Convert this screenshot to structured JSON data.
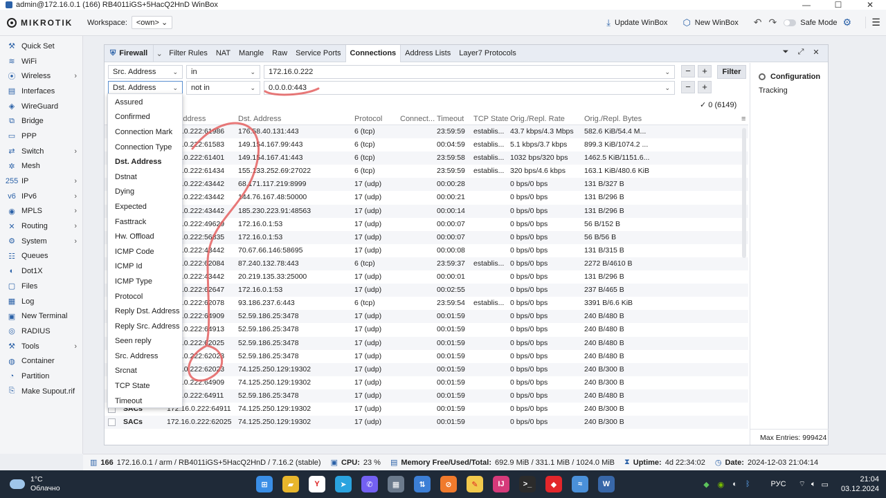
{
  "window": {
    "title": "admin@172.16.0.1 (166) RB4011iGS+5HacQ2HnD WinBox",
    "controls": [
      "—",
      "☐",
      "✕"
    ]
  },
  "toolbar": {
    "logo": "MIKROTIK",
    "workspace_label": "Workspace:",
    "workspace_value": "<own>",
    "update_label": "Update WinBox",
    "new_label": "New WinBox",
    "safe_mode_label": "Safe Mode"
  },
  "sidebar": {
    "items": [
      {
        "label": "Quick Set",
        "icon": "quickset-icon",
        "glyph": "⚒",
        "arrow": ""
      },
      {
        "label": "WiFi",
        "icon": "wifi-icon",
        "glyph": "≋",
        "arrow": ""
      },
      {
        "label": "Wireless",
        "icon": "wireless-icon",
        "glyph": "⦿",
        "arrow": "›"
      },
      {
        "label": "Interfaces",
        "icon": "interfaces-icon",
        "glyph": "▤",
        "arrow": ""
      },
      {
        "label": "WireGuard",
        "icon": "wireguard-icon",
        "glyph": "◈",
        "arrow": ""
      },
      {
        "label": "Bridge",
        "icon": "bridge-icon",
        "glyph": "⧉",
        "arrow": ""
      },
      {
        "label": "PPP",
        "icon": "ppp-icon",
        "glyph": "▭",
        "arrow": ""
      },
      {
        "label": "Switch",
        "icon": "switch-icon",
        "glyph": "⇄",
        "arrow": "›"
      },
      {
        "label": "Mesh",
        "icon": "mesh-icon",
        "glyph": "✲",
        "arrow": ""
      },
      {
        "label": "IP",
        "icon": "ip-icon",
        "glyph": "255",
        "arrow": "›"
      },
      {
        "label": "IPv6",
        "icon": "ipv6-icon",
        "glyph": "v6",
        "arrow": "›"
      },
      {
        "label": "MPLS",
        "icon": "mpls-icon",
        "glyph": "◉",
        "arrow": "›"
      },
      {
        "label": "Routing",
        "icon": "routing-icon",
        "glyph": "✕",
        "arrow": "›"
      },
      {
        "label": "System",
        "icon": "system-icon",
        "glyph": "⚙",
        "arrow": "›"
      },
      {
        "label": "Queues",
        "icon": "queues-icon",
        "glyph": "☷",
        "arrow": ""
      },
      {
        "label": "Dot1X",
        "icon": "dot1x-icon",
        "glyph": "◐",
        "arrow": ""
      },
      {
        "label": "Files",
        "icon": "files-icon",
        "glyph": "▢",
        "arrow": ""
      },
      {
        "label": "Log",
        "icon": "log-icon",
        "glyph": "▦",
        "arrow": ""
      },
      {
        "label": "New Terminal",
        "icon": "terminal-icon",
        "glyph": "▣",
        "arrow": ""
      },
      {
        "label": "RADIUS",
        "icon": "radius-icon",
        "glyph": "◎",
        "arrow": ""
      },
      {
        "label": "Tools",
        "icon": "tools-icon",
        "glyph": "⚒",
        "arrow": "›"
      },
      {
        "label": "Container",
        "icon": "container-icon",
        "glyph": "◍",
        "arrow": ""
      },
      {
        "label": "Partition",
        "icon": "partition-icon",
        "glyph": "◔",
        "arrow": ""
      },
      {
        "label": "Make Supout.rif",
        "icon": "supout-icon",
        "glyph": "⎘",
        "arrow": ""
      }
    ]
  },
  "firewall": {
    "root_label": "Firewall",
    "tabs": [
      "Filter Rules",
      "NAT",
      "Mangle",
      "Raw",
      "Service Ports",
      "Connections",
      "Address Lists",
      "Layer7 Protocols"
    ],
    "active_tab": "Connections",
    "filter1": {
      "field": "Src. Address",
      "op": "in",
      "value": "172.16.0.222"
    },
    "filter2": {
      "field": "Dst. Address",
      "op": "not in",
      "value": "0.0.0.0:443"
    },
    "filter_button": "Filter",
    "count": "0 (6149)",
    "config_title": "Configuration",
    "config_item": "Tracking",
    "max_entries": "Max Entries: 999424"
  },
  "dropdown": {
    "items": [
      "Assured",
      "Confirmed",
      "Connection Mark",
      "Connection Type",
      "Dst. Address",
      "Dstnat",
      "Dying",
      "Expected",
      "Fasttrack",
      "Hw. Offload",
      "ICMP Code",
      "ICMP Id",
      "ICMP Type",
      "Protocol",
      "Reply Dst. Address",
      "Reply Src. Address",
      "Seen reply",
      "Src. Address",
      "Srcnat",
      "TCP State",
      "Timeout"
    ],
    "selected": "Dst. Address"
  },
  "table": {
    "headers": [
      "Address",
      "Dst. Address",
      "Protocol",
      "Connect...",
      "Timeout",
      "TCP State",
      "Orig./Repl. Rate",
      "Orig./Repl. Bytes"
    ],
    "rows": [
      {
        "flag": "",
        "src": "6.0.222:61986",
        "dst": "176.58.40.131:443",
        "proto": "6 (tcp)",
        "conn": "",
        "timeout": "23:59:59",
        "state": "establis...",
        "rate": "43.7 kbps/4.3 Mbps",
        "bytes": "582.6 KiB/54.4 M..."
      },
      {
        "flag": "",
        "src": "6.0.222:61583",
        "dst": "149.154.167.99:443",
        "proto": "6 (tcp)",
        "conn": "",
        "timeout": "00:04:59",
        "state": "establis...",
        "rate": "5.1 kbps/3.7 kbps",
        "bytes": "899.3 KiB/1074.2 ..."
      },
      {
        "flag": "",
        "src": "6.0.222:61401",
        "dst": "149.154.167.41:443",
        "proto": "6 (tcp)",
        "conn": "",
        "timeout": "23:59:58",
        "state": "establis...",
        "rate": "1032 bps/320 bps",
        "bytes": "1462.5 KiB/1151.6..."
      },
      {
        "flag": "",
        "src": "6.0.222:61434",
        "dst": "155.133.252.69:27022",
        "proto": "6 (tcp)",
        "conn": "",
        "timeout": "23:59:59",
        "state": "establis...",
        "rate": "320 bps/4.6 kbps",
        "bytes": "163.1 KiB/480.6 KiB"
      },
      {
        "flag": "",
        "src": "6.0.222:43442",
        "dst": "68.171.117.219:8999",
        "proto": "17 (udp)",
        "conn": "",
        "timeout": "00:00:28",
        "state": "",
        "rate": "0 bps/0 bps",
        "bytes": "131 B/327 B"
      },
      {
        "flag": "",
        "src": "6.0.222:43442",
        "dst": "144.76.167.48:50000",
        "proto": "17 (udp)",
        "conn": "",
        "timeout": "00:00:21",
        "state": "",
        "rate": "0 bps/0 bps",
        "bytes": "131 B/296 B"
      },
      {
        "flag": "",
        "src": "6.0.222:43442",
        "dst": "185.230.223.91:48563",
        "proto": "17 (udp)",
        "conn": "",
        "timeout": "00:00:14",
        "state": "",
        "rate": "0 bps/0 bps",
        "bytes": "131 B/296 B"
      },
      {
        "flag": "",
        "src": "6.0.222:49629",
        "dst": "172.16.0.1:53",
        "proto": "17 (udp)",
        "conn": "",
        "timeout": "00:00:07",
        "state": "",
        "rate": "0 bps/0 bps",
        "bytes": "56 B/152 B"
      },
      {
        "flag": "",
        "src": "6.0.222:56835",
        "dst": "172.16.0.1:53",
        "proto": "17 (udp)",
        "conn": "",
        "timeout": "00:00:07",
        "state": "",
        "rate": "0 bps/0 bps",
        "bytes": "56 B/56 B"
      },
      {
        "flag": "",
        "src": "6.0.222:43442",
        "dst": "70.67.66.146:58695",
        "proto": "17 (udp)",
        "conn": "",
        "timeout": "00:00:08",
        "state": "",
        "rate": "0 bps/0 bps",
        "bytes": "131 B/315 B"
      },
      {
        "flag": "",
        "src": "6.0.222:62084",
        "dst": "87.240.132.78:443",
        "proto": "6 (tcp)",
        "conn": "",
        "timeout": "23:59:37",
        "state": "establis...",
        "rate": "0 bps/0 bps",
        "bytes": "2272 B/4610 B"
      },
      {
        "flag": "",
        "src": "6.0.222:43442",
        "dst": "20.219.135.33:25000",
        "proto": "17 (udp)",
        "conn": "",
        "timeout": "00:00:01",
        "state": "",
        "rate": "0 bps/0 bps",
        "bytes": "131 B/296 B"
      },
      {
        "flag": "",
        "src": "6.0.222:62647",
        "dst": "172.16.0.1:53",
        "proto": "17 (udp)",
        "conn": "",
        "timeout": "00:02:55",
        "state": "",
        "rate": "0 bps/0 bps",
        "bytes": "237 B/465 B"
      },
      {
        "flag": "",
        "src": "6.0.222:62078",
        "dst": "93.186.237.6:443",
        "proto": "6 (tcp)",
        "conn": "",
        "timeout": "23:59:54",
        "state": "establis...",
        "rate": "0 bps/0 bps",
        "bytes": "3391 B/6.6 KiB"
      },
      {
        "flag": "",
        "src": "6.0.222:64909",
        "dst": "52.59.186.25:3478",
        "proto": "17 (udp)",
        "conn": "",
        "timeout": "00:01:59",
        "state": "",
        "rate": "0 bps/0 bps",
        "bytes": "240 B/480 B"
      },
      {
        "flag": "",
        "src": "6.0.222:64913",
        "dst": "52.59.186.25:3478",
        "proto": "17 (udp)",
        "conn": "",
        "timeout": "00:01:59",
        "state": "",
        "rate": "0 bps/0 bps",
        "bytes": "240 B/480 B"
      },
      {
        "flag": "",
        "src": "6.0.222:62025",
        "dst": "52.59.186.25:3478",
        "proto": "17 (udp)",
        "conn": "",
        "timeout": "00:01:59",
        "state": "",
        "rate": "0 bps/0 bps",
        "bytes": "240 B/480 B"
      },
      {
        "flag": "",
        "src": "6.0.222:62023",
        "dst": "52.59.186.25:3478",
        "proto": "17 (udp)",
        "conn": "",
        "timeout": "00:01:59",
        "state": "",
        "rate": "0 bps/0 bps",
        "bytes": "240 B/480 B"
      },
      {
        "flag": "",
        "src": "6.0.222:62023",
        "dst": "74.125.250.129:19302",
        "proto": "17 (udp)",
        "conn": "",
        "timeout": "00:01:59",
        "state": "",
        "rate": "0 bps/0 bps",
        "bytes": "240 B/300 B"
      },
      {
        "flag": "",
        "src": "6.0.222:64909",
        "dst": "74.125.250.129:19302",
        "proto": "17 (udp)",
        "conn": "",
        "timeout": "00:01:59",
        "state": "",
        "rate": "0 bps/0 bps",
        "bytes": "240 B/300 B"
      },
      {
        "flag": "",
        "src": "6.0.222:64911",
        "dst": "52.59.186.25:3478",
        "proto": "17 (udp)",
        "conn": "",
        "timeout": "00:01:59",
        "state": "",
        "rate": "0 bps/0 bps",
        "bytes": "240 B/480 B"
      },
      {
        "flag": "SACs",
        "src": "172.16.0.222:64911",
        "dst": "74.125.250.129:19302",
        "proto": "17 (udp)",
        "conn": "",
        "timeout": "00:01:59",
        "state": "",
        "rate": "0 bps/0 bps",
        "bytes": "240 B/300 B"
      },
      {
        "flag": "SACs",
        "src": "172.16.0.222:62025",
        "dst": "74.125.250.129:19302",
        "proto": "17 (udp)",
        "conn": "",
        "timeout": "00:01:59",
        "state": "",
        "rate": "0 bps/0 bps",
        "bytes": "240 B/300 B"
      }
    ]
  },
  "status": {
    "device_count": "166",
    "device": "172.16.0.1 / arm / RB4011iGS+5HacQ2HnD / 7.16.2 (stable)",
    "cpu_label": "CPU:",
    "cpu_value": "23 %",
    "mem_label": "Memory Free/Used/Total:",
    "mem_value": "692.9 MiB / 331.1 MiB / 1024.0 MiB",
    "uptime_label": "Uptime:",
    "uptime_value": "4d 22:34:02",
    "date_label": "Date:",
    "date_value": "2024-12-03 21:04:14"
  },
  "taskbar": {
    "temp": "1°C",
    "weather": "Облачно",
    "lang": "РУС",
    "time": "21:04",
    "date": "03.12.2024",
    "apps": [
      {
        "name": "start-icon",
        "color": "#3a8ee6",
        "glyph": "⊞"
      },
      {
        "name": "explorer-icon",
        "color": "#e8b62c",
        "glyph": "▰"
      },
      {
        "name": "yandex-browser-icon",
        "color": "#ffffff",
        "glyph": "Y"
      },
      {
        "name": "telegram-icon",
        "color": "#2aa3df",
        "glyph": "➤"
      },
      {
        "name": "viber-icon",
        "color": "#7360f2",
        "glyph": "✆"
      },
      {
        "name": "calculator-icon",
        "color": "#6b7a8c",
        "glyph": "▦"
      },
      {
        "name": "network-icon",
        "color": "#3c7fd6",
        "glyph": "⇅"
      },
      {
        "name": "browser-icon",
        "color": "#f07a2c",
        "glyph": "⊘"
      },
      {
        "name": "notes-icon",
        "color": "#f2c94c",
        "glyph": "✎"
      },
      {
        "name": "ide-icon",
        "color": "#d63a7a",
        "glyph": "IJ"
      },
      {
        "name": "terminal-app-icon",
        "color": "#2b2b2b",
        "glyph": ">_"
      },
      {
        "name": "anydesk-icon",
        "color": "#e3262b",
        "glyph": "◆"
      },
      {
        "name": "shark-icon",
        "color": "#4a90d9",
        "glyph": "≈"
      },
      {
        "name": "winbox-app-icon",
        "color": "#3867a8",
        "glyph": "W"
      }
    ]
  }
}
